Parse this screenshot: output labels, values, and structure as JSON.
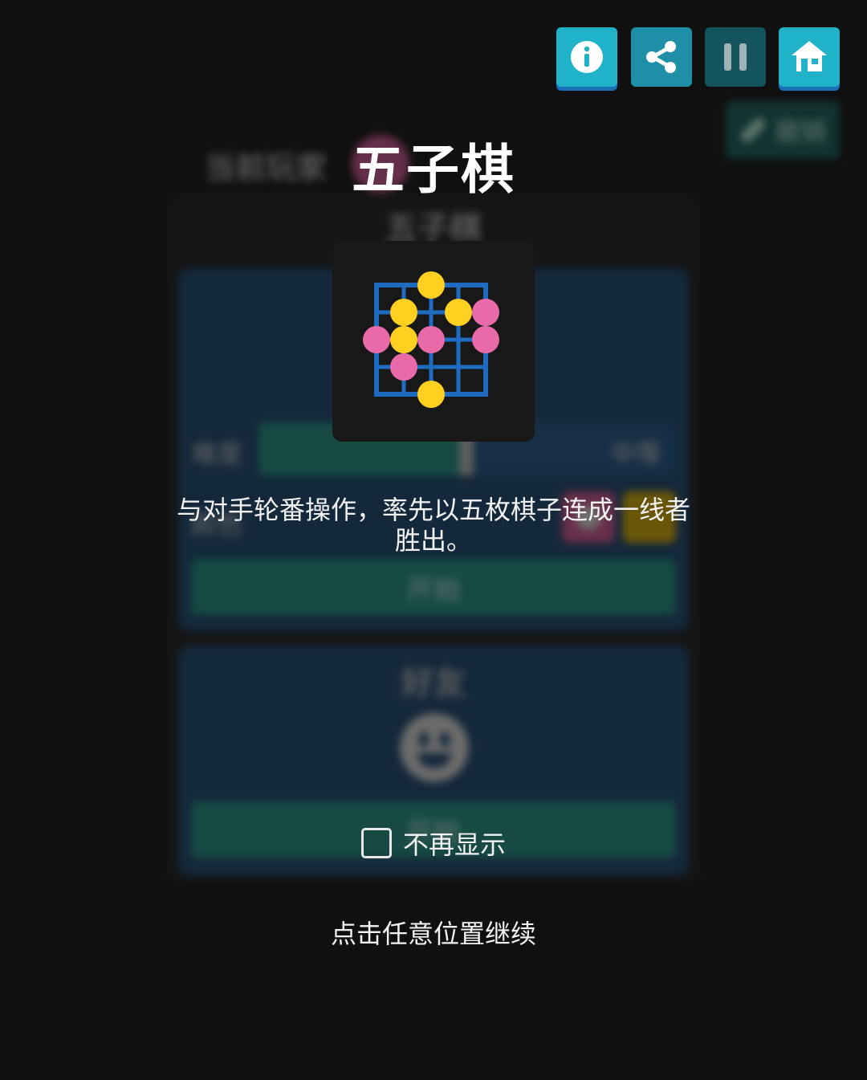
{
  "colors": {
    "background": "#101010",
    "board_grid": "#1e6bc0",
    "stone_yellow": "#ffd020",
    "stone_pink": "#e86aa8",
    "button_cyan": "#1fb2c8",
    "button_teal": "#1e8fa6",
    "button_dark_teal": "#14545c"
  },
  "toolbar": {
    "buttons": [
      {
        "name": "info",
        "icon": "info-icon"
      },
      {
        "name": "share",
        "icon": "share-icon"
      },
      {
        "name": "pause",
        "icon": "pause-icon"
      },
      {
        "name": "home",
        "icon": "home-icon"
      }
    ]
  },
  "background": {
    "undo_label": "撤销",
    "current_player_label": "当前玩家",
    "panel_title": "五子棋",
    "difficulty_label": "难度",
    "difficulty_value": "中等",
    "difficulty_level": 0.5,
    "color_label": "颜色",
    "start_label": "开始",
    "friend_title": "好友",
    "friend_start_label": "开始"
  },
  "tutorial": {
    "title": "五子棋",
    "logo_icon": "gomoku-board-icon",
    "description": "与对手轮番操作，率先以五枚棋子连成一线者胜出。",
    "dont_show_label": "不再显示",
    "dont_show_checked": false,
    "continue_hint": "点击任意位置继续"
  }
}
